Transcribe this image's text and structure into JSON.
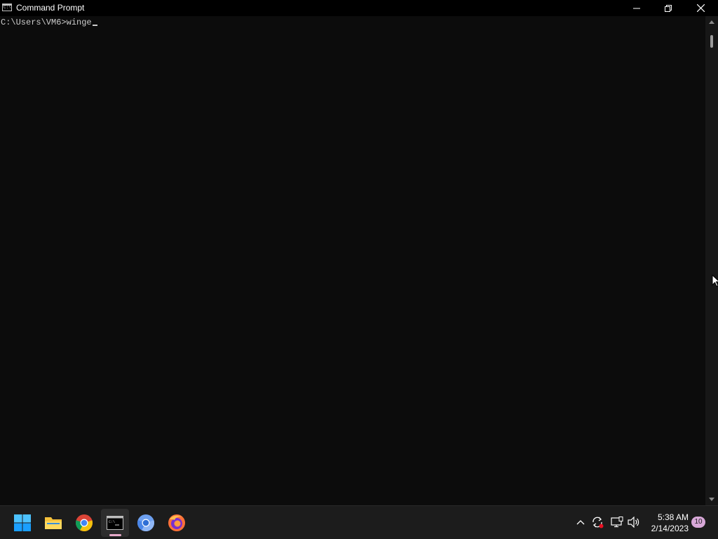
{
  "window": {
    "title": "Command Prompt",
    "app_icon_text": "C:\\"
  },
  "console": {
    "prompt": "C:\\Users\\VM6>",
    "input": "winge"
  },
  "taskbar": {
    "apps": [
      {
        "name": "Start",
        "icon": "windows-start-icon"
      },
      {
        "name": "File Explorer",
        "icon": "folder-icon"
      },
      {
        "name": "Google Chrome",
        "icon": "chrome-icon"
      },
      {
        "name": "Command Prompt",
        "icon": "cmd-icon",
        "active": true
      },
      {
        "name": "Chromium",
        "icon": "chromium-icon"
      },
      {
        "name": "Firefox",
        "icon": "firefox-icon"
      }
    ],
    "tray": {
      "time": "5:38 AM",
      "date": "2/14/2023",
      "notifications": "10"
    }
  },
  "colors": {
    "console_bg": "#0c0c0c",
    "console_fg": "#cccccc",
    "titlebar_bg": "#000000",
    "taskbar_bg": "#1c1c1c",
    "accent": "#e6a9c9"
  }
}
